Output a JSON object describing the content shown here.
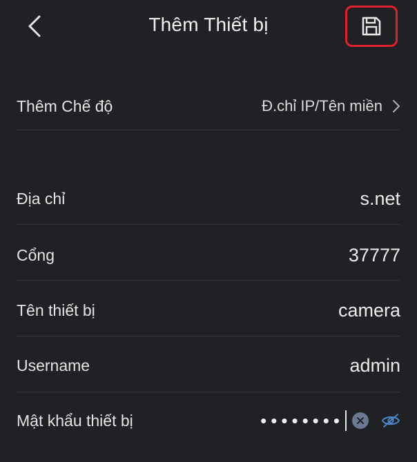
{
  "header": {
    "title": "Thêm Thiết bị",
    "back_icon": "chevron-left-icon",
    "save_icon": "floppy-disk-icon",
    "highlight_color": "#e0222c"
  },
  "form": {
    "mode": {
      "label": "Thêm Chế độ",
      "value": "Đ.chỉ IP/Tên miền"
    },
    "address": {
      "label": "Địa chỉ",
      "value": "s.net"
    },
    "port": {
      "label": "Cổng",
      "value": "37777"
    },
    "device_name": {
      "label": "Tên thiết bị",
      "value": "camera"
    },
    "username": {
      "label": "Username",
      "value": "admin"
    },
    "password": {
      "label": "Mật khẩu thiết bị",
      "masked_value": "••••••••"
    }
  },
  "colors": {
    "background": "#202124",
    "accent_blue": "#4a86c8"
  }
}
